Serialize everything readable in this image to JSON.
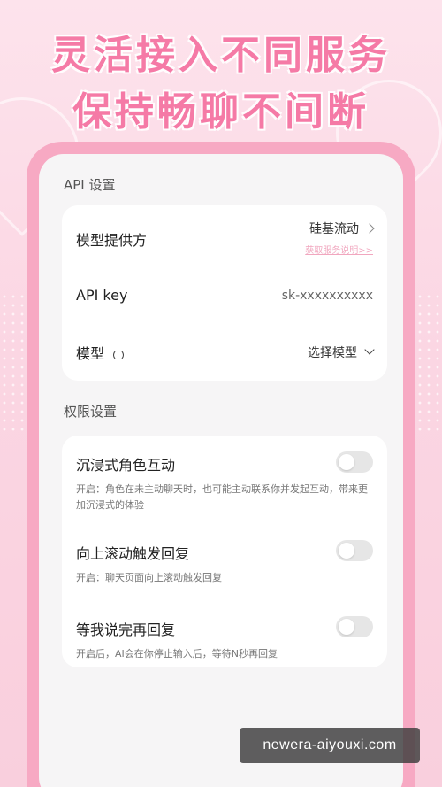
{
  "headline": {
    "line1": "灵活接入不同服务",
    "line2": "保持畅聊不间断"
  },
  "api_section": {
    "title": "API 设置",
    "provider": {
      "label": "模型提供方",
      "value": "硅基流动",
      "hint": "获取服务说明>>"
    },
    "api_key": {
      "label": "API key",
      "value": "sk-xxxxxxxxxx"
    },
    "model": {
      "label": "模型",
      "value": "选择模型"
    }
  },
  "permission_section": {
    "title": "权限设置",
    "items": [
      {
        "label": "沉浸式角色互动",
        "desc": "开启：角色在未主动聊天时，也可能主动联系你并发起互动，带来更加沉浸式的体验",
        "enabled": false
      },
      {
        "label": "向上滚动触发回复",
        "desc": "开启：聊天页面向上滚动触发回复",
        "enabled": false
      },
      {
        "label": "等我说完再回复",
        "desc": "开启后，AI会在你停止输入后，等待N秒再回复",
        "enabled": false
      }
    ]
  },
  "watermark": "newera-aiyouxi.com",
  "colors": {
    "accent": "#f57aa6",
    "phone_frame": "#f7a9c3"
  }
}
